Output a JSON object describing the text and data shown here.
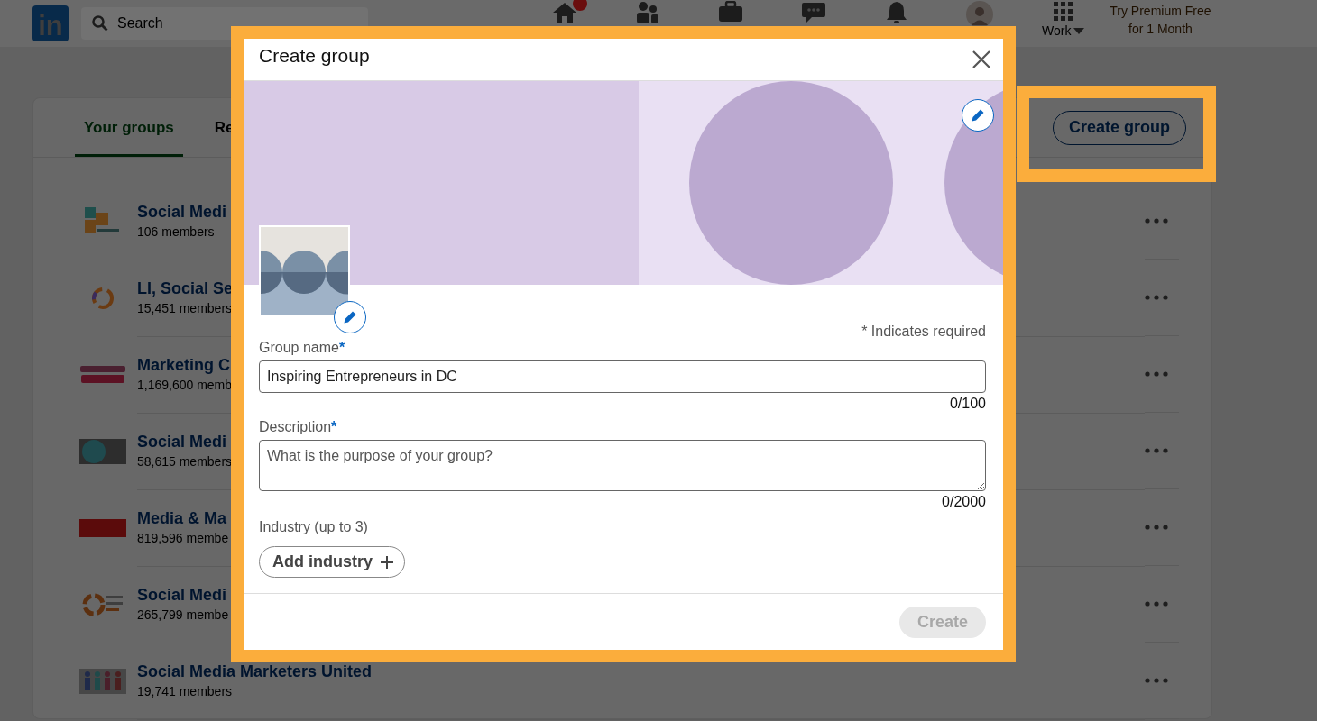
{
  "header": {
    "logo": "in",
    "search": {
      "placeholder": "Search"
    },
    "nav": [
      {
        "kind": "home",
        "badge": true
      },
      {
        "kind": "people",
        "badge": false
      },
      {
        "kind": "briefcase",
        "badge": false
      },
      {
        "kind": "chat",
        "badge": false
      },
      {
        "kind": "bell",
        "badge": false
      },
      {
        "kind": "avatar",
        "badge": false
      }
    ],
    "work": "Work",
    "premium": "Try Premium Free for 1 Month"
  },
  "groups_page": {
    "tabs": [
      {
        "label": "Your groups",
        "selected": true
      },
      {
        "label": "Re",
        "selected": false
      }
    ],
    "create_button": "Create group",
    "groups": [
      {
        "kind": "squares",
        "name": "Social Medi",
        "members": "106 members"
      },
      {
        "kind": "ring",
        "name": "LI, Social Se",
        "members": "15,451 members"
      },
      {
        "kind": "wordmark",
        "name": "Marketing C",
        "members": "1,169,600 memb"
      },
      {
        "kind": "tile",
        "name": "Social Medi",
        "members": "58,615 members"
      },
      {
        "kind": "banner",
        "name": "Media & Ma",
        "members": "819,596 membe"
      },
      {
        "kind": "swirl",
        "name": "Social Medi",
        "members": "265,799 membe"
      },
      {
        "kind": "people",
        "name": "Social Media Marketers United",
        "members": "19,741 members"
      }
    ]
  },
  "dialog": {
    "title": "Create group",
    "required_note": "* Indicates required",
    "fields": [
      {
        "kind": "input",
        "label": "Group name",
        "required_mark": "*",
        "value": "Inspiring Entrepreneurs in DC",
        "counter": "0/100"
      },
      {
        "kind": "textarea",
        "label": "Description",
        "required_mark": "*",
        "placeholder": "What is the purpose of your group?",
        "counter": "0/2000"
      }
    ],
    "industry": {
      "label": "Industry (up to 3)",
      "button": "Add industry"
    },
    "create": {
      "label": "Create",
      "disabled": true
    }
  }
}
